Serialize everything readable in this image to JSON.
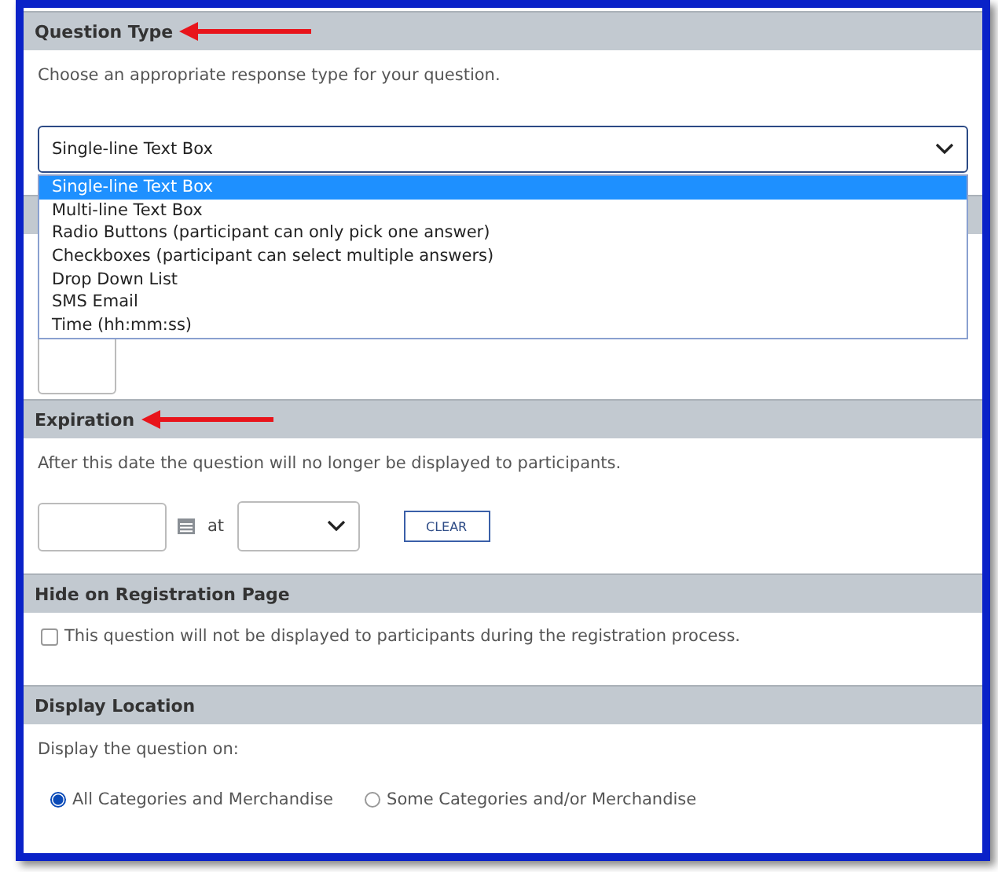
{
  "question_type": {
    "title": "Question Type",
    "annotated": true,
    "description": "Choose an appropriate response type for your question.",
    "select_value": "Single-line Text Box",
    "options": [
      {
        "label": "Single-line Text Box",
        "selected": true
      },
      {
        "label": "Multi-line Text Box",
        "selected": false
      },
      {
        "label": "Radio Buttons (participant can only pick one answer)",
        "selected": false
      },
      {
        "label": "Checkboxes (participant can select multiple answers)",
        "selected": false
      },
      {
        "label": "Drop Down List",
        "selected": false
      },
      {
        "label": "SMS Email",
        "selected": false
      },
      {
        "label": "Time (hh:mm:ss)",
        "selected": false
      }
    ]
  },
  "expiration": {
    "title": "Expiration",
    "annotated": true,
    "description": "After this date the question will no longer be displayed to participants.",
    "at_label": "at",
    "clear_button": "CLEAR"
  },
  "hide_on_registration": {
    "title": "Hide on Registration Page",
    "checkbox_label": "This question will not be displayed to participants during the registration process.",
    "checked": false
  },
  "display_location": {
    "title": "Display Location",
    "prompt": "Display the question on:",
    "options": [
      {
        "label": "All Categories and Merchandise",
        "selected": true
      },
      {
        "label": "Some Categories and/or Merchandise",
        "selected": false
      }
    ]
  }
}
